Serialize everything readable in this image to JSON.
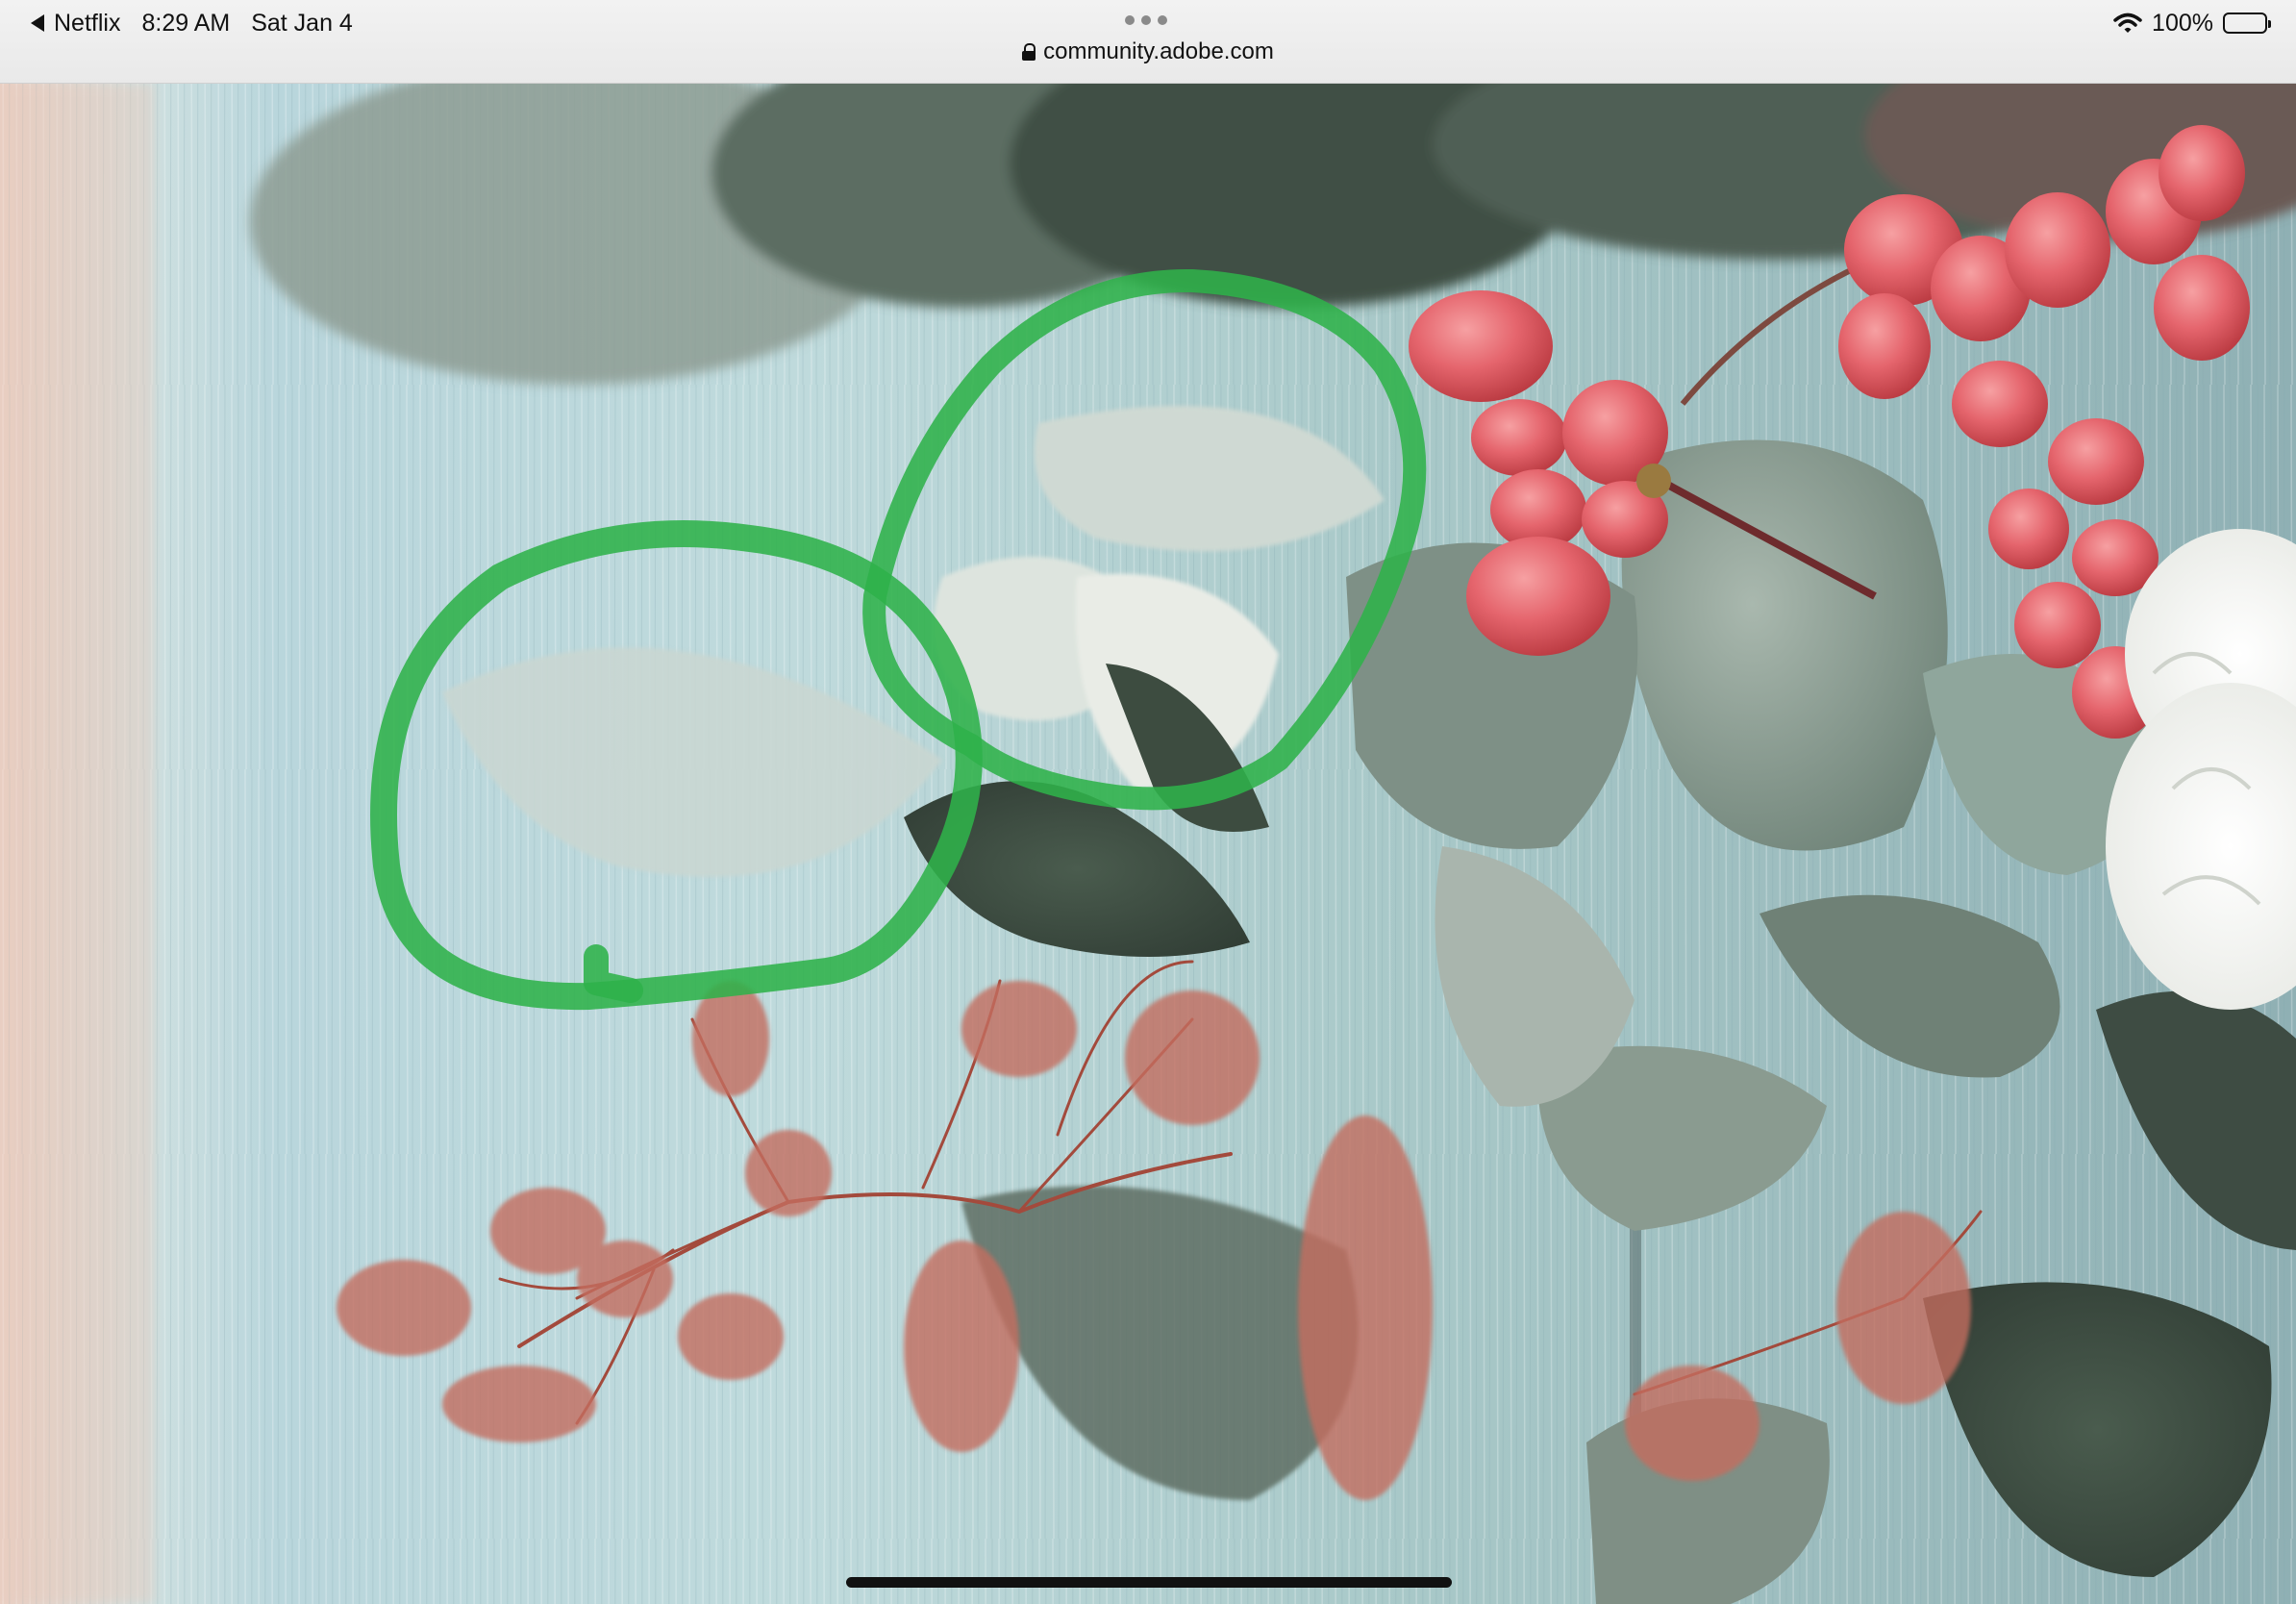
{
  "status_bar": {
    "back_app": "Netflix",
    "time": "8:29 AM",
    "date": "Sat Jan 4",
    "url": "community.adobe.com",
    "battery": "100%"
  },
  "icons": {
    "back": "back-triangle-icon",
    "tab_menu": "more-dots-icon",
    "secure": "lock-icon",
    "wifi": "wifi-icon",
    "battery": "battery-icon"
  },
  "colors": {
    "annotation_stroke": "#2fb24a",
    "wood_background": "#bcd8dc",
    "berry": "#e0606a"
  }
}
